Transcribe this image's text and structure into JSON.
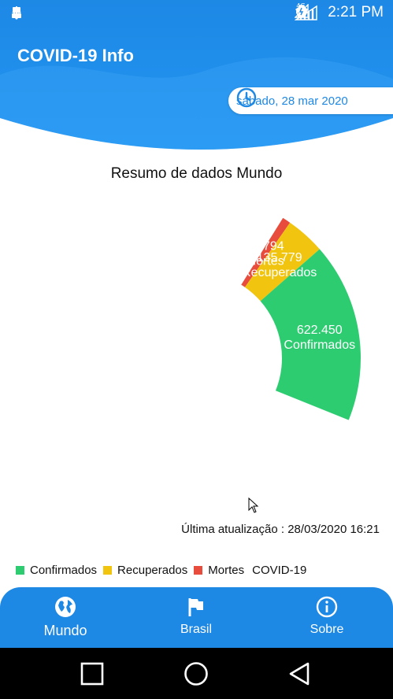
{
  "status_bar": {
    "left_icons": [
      "battery-100-icon",
      "usb-icon",
      "android-icon"
    ],
    "right_icons": [
      "vibrate-icon",
      "alarm-icon",
      "wifi-icon",
      "signal-4g-icon",
      "signal-icon",
      "battery-charging-icon"
    ],
    "network_badge": "4G",
    "time": "2:21 PM"
  },
  "header": {
    "title": "COVID-19 Info",
    "date": "sábado, 28 mar 2020",
    "colors": {
      "primary": "#1e88e5",
      "light": "#2196f3"
    }
  },
  "main": {
    "title": "Resumo de dados Mundo",
    "last_update": "Última atualização : 28/03/2020 16:21"
  },
  "chart_data": {
    "type": "pie",
    "slices": [
      {
        "name": "Confirmados",
        "value": 622450,
        "label_value": "622.450",
        "label_name": "Confirmados",
        "color": "#2ecc71"
      },
      {
        "name": "Recuperados",
        "value": 135779,
        "label_value": "135.779",
        "label_name": "Recuperados",
        "color": "#f1c40f"
      },
      {
        "name": "Mortes",
        "value": 28794,
        "label_value": "28.794",
        "label_name": "Mortes",
        "color": "#e74c3c"
      }
    ],
    "legend_position": "bottom-left"
  },
  "legend": {
    "items": [
      {
        "label": "Confirmados",
        "color": "#2ecc71"
      },
      {
        "label": "Recuperados",
        "color": "#f1c40f"
      },
      {
        "label": "Mortes",
        "color": "#e74c3c"
      }
    ],
    "caption": "COVID-19"
  },
  "bottom_nav": {
    "items": [
      {
        "label": "Mundo",
        "icon": "globe-icon"
      },
      {
        "label": "Brasil",
        "icon": "flag-icon"
      },
      {
        "label": "Sobre",
        "icon": "info-icon"
      }
    ]
  },
  "system_nav": {
    "buttons": [
      "recents-button",
      "home-button",
      "back-button"
    ]
  }
}
